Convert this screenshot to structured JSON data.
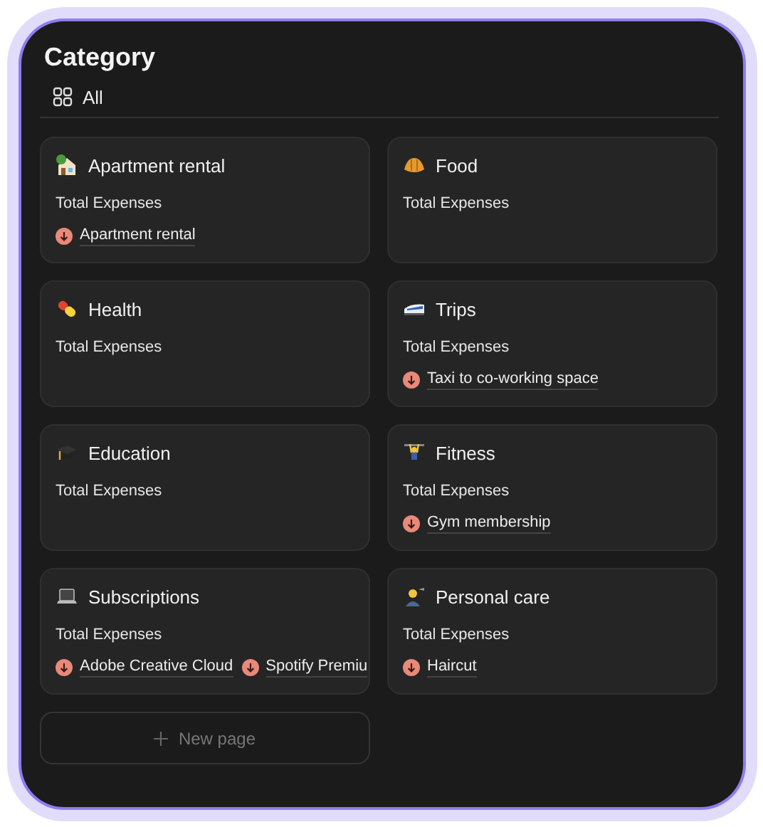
{
  "title": "Category",
  "view_tab": {
    "label": "All"
  },
  "cards": [
    {
      "title": "Apartment rental",
      "label": "Total Expenses",
      "items": [
        "Apartment rental"
      ]
    },
    {
      "title": "Food",
      "label": "Total Expenses"
    },
    {
      "title": "Health",
      "label": "Total Expenses"
    },
    {
      "title": "Trips",
      "label": "Total Expenses",
      "items": [
        "Taxi to co-working space"
      ]
    },
    {
      "title": "Education",
      "label": "Total Expenses"
    },
    {
      "title": "Fitness",
      "label": "Total Expenses",
      "items": [
        "Gym membership"
      ]
    },
    {
      "title": "Subscriptions",
      "label": "Total Expenses",
      "items": [
        "Adobe Creative Cloud",
        "Spotify Premiu"
      ]
    },
    {
      "title": "Personal care",
      "label": "Total Expenses",
      "items": [
        "Haircut"
      ]
    }
  ],
  "new_page_button": {
    "label": "New page"
  }
}
